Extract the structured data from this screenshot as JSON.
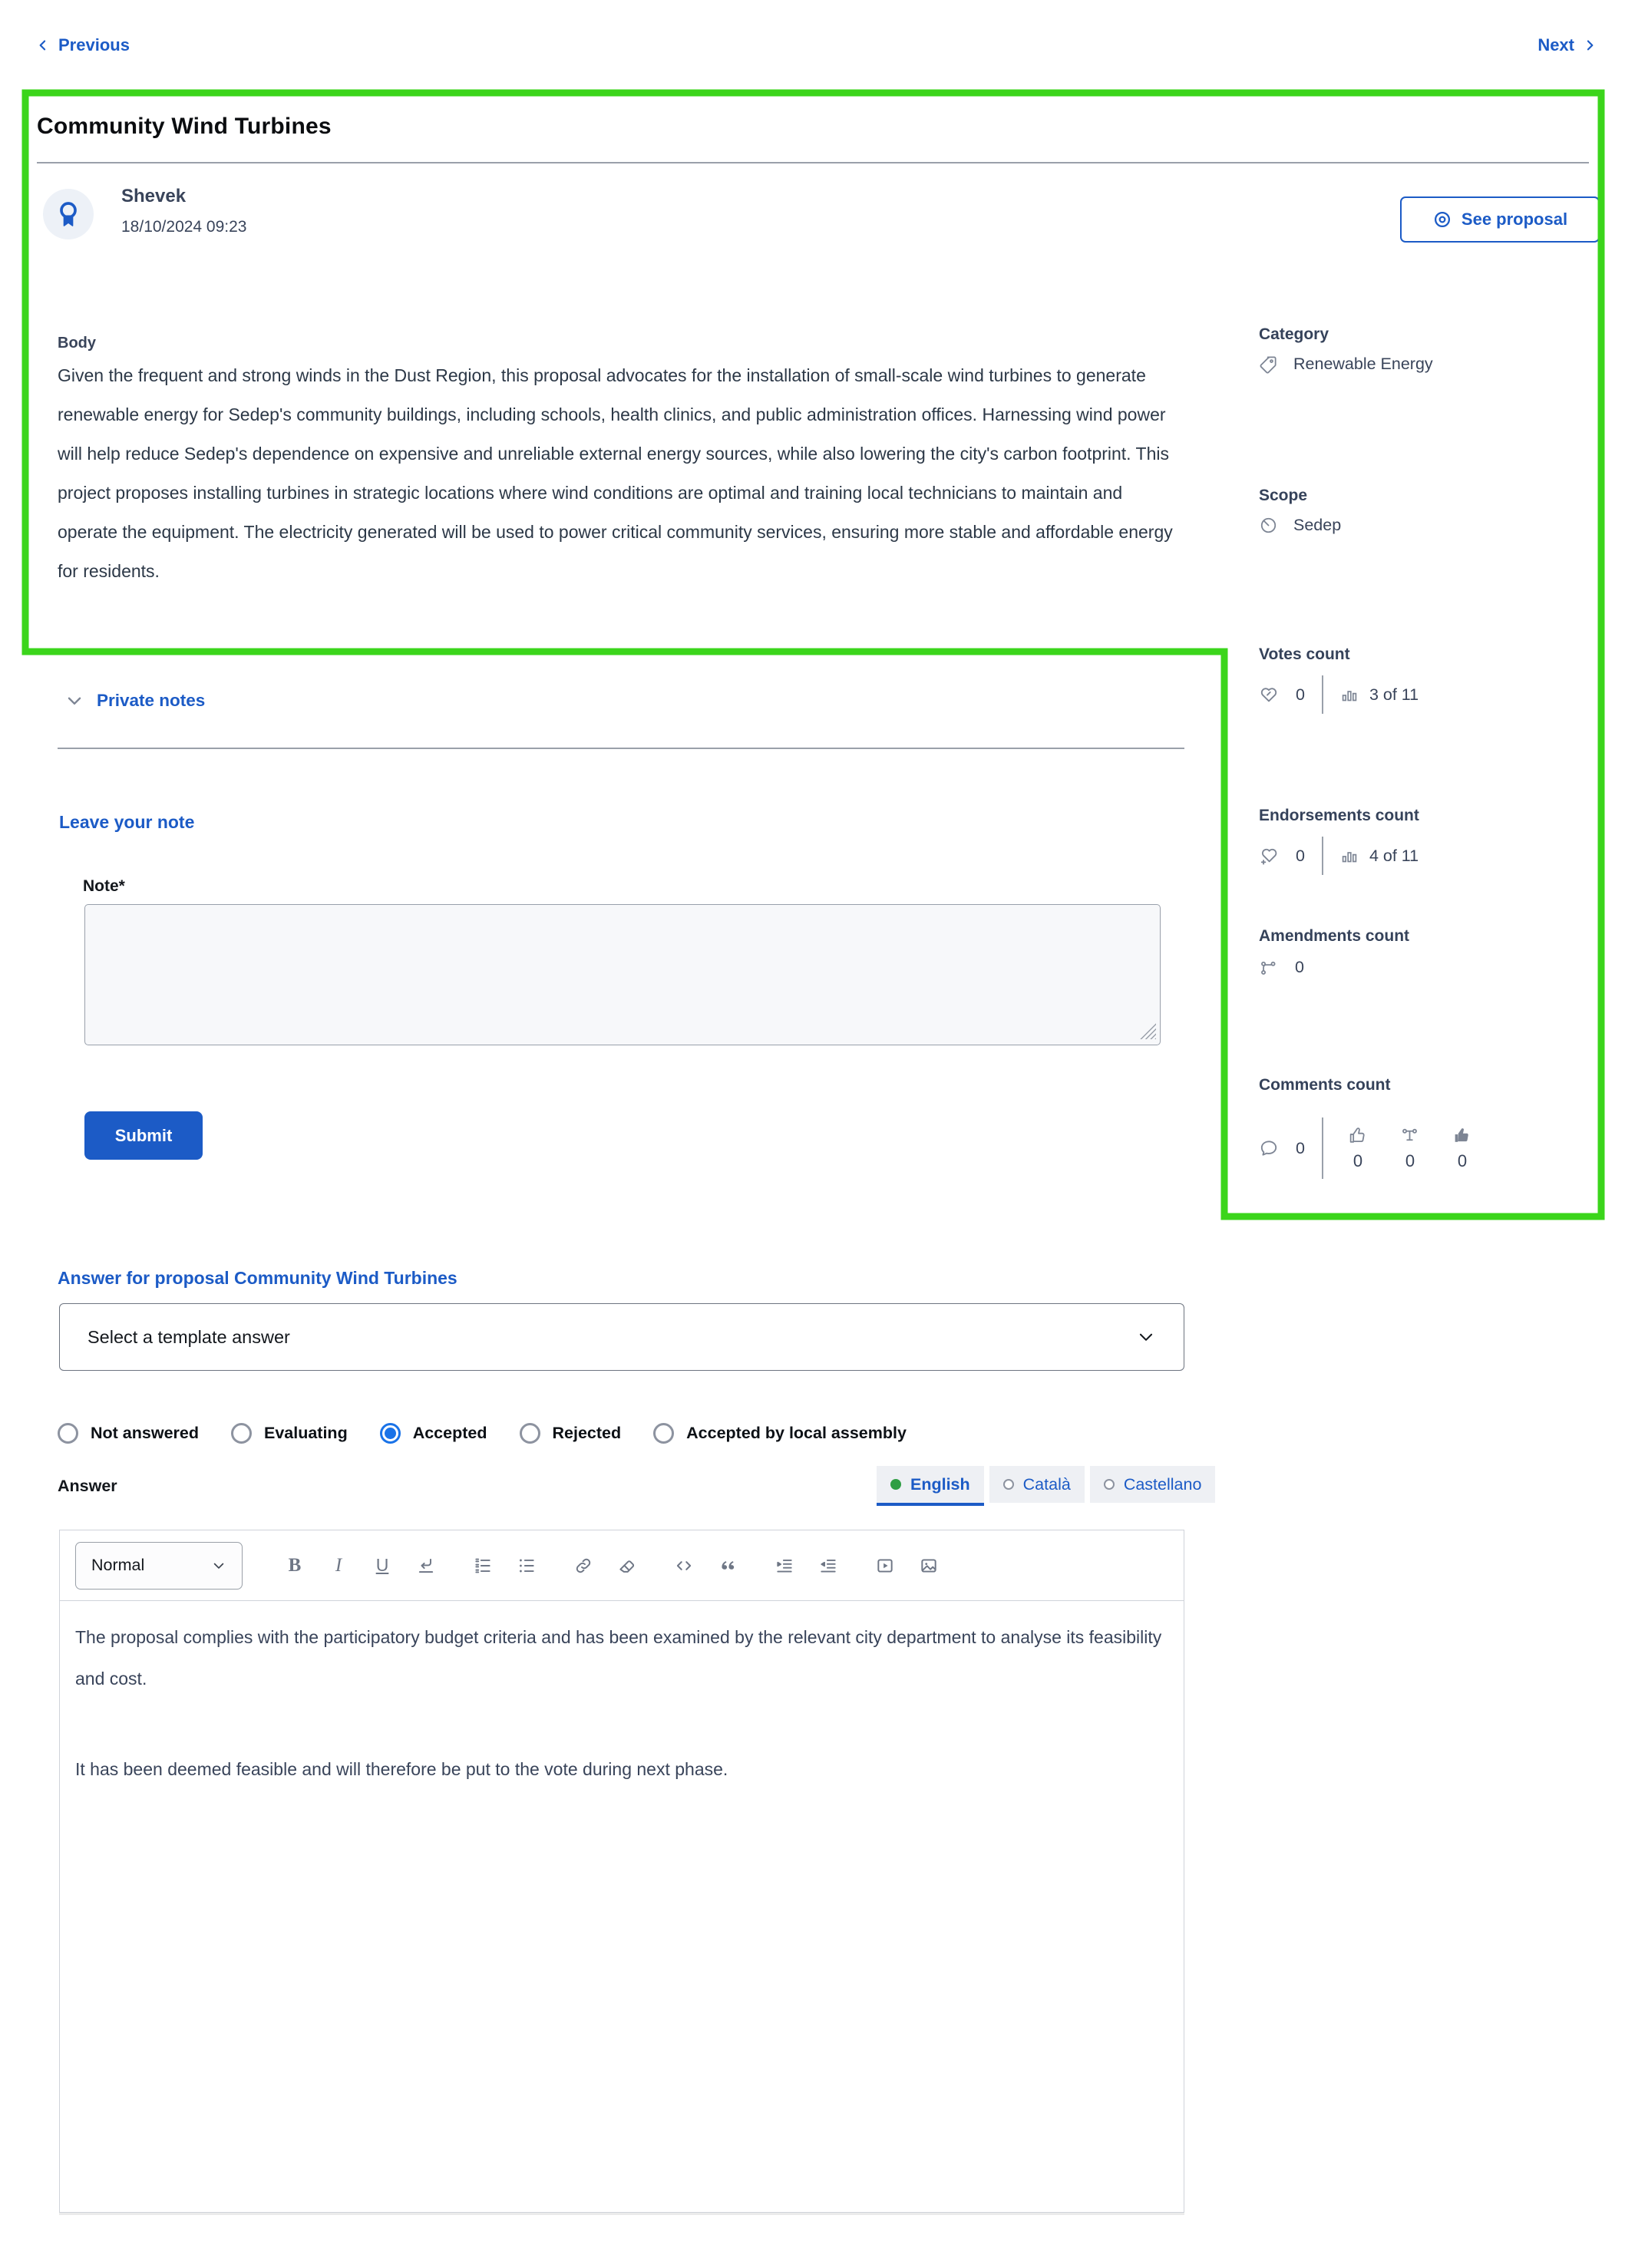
{
  "nav": {
    "previous": "Previous",
    "next": "Next"
  },
  "proposal": {
    "title": "Community Wind Turbines",
    "author": {
      "name": "Shevek",
      "date": "18/10/2024 09:23"
    },
    "see_proposal_label": "See proposal",
    "body_label": "Body",
    "body": "Given the frequent and strong winds in the Dust Region, this proposal advocates for the installation of small-scale wind turbines to generate renewable energy for Sedep's community buildings, including schools, health clinics, and public administration offices. Harnessing wind power will help reduce Sedep's dependence on expensive and unreliable external energy sources, while also lowering the city's carbon footprint. This project proposes installing turbines in strategic locations where wind conditions are optimal and training local technicians to maintain and operate the equipment. The electricity generated will be used to power critical community services, ensuring more stable and affordable energy for residents."
  },
  "details": {
    "category": {
      "label": "Category",
      "value": "Renewable Energy"
    },
    "scope": {
      "label": "Scope",
      "value": "Sedep"
    },
    "votes": {
      "label": "Votes count",
      "count": "0",
      "ranking": "3 of 11"
    },
    "endorsements": {
      "label": "Endorsements count",
      "count": "0",
      "ranking": "4 of 11"
    },
    "amendments": {
      "label": "Amendments count",
      "count": "0"
    },
    "comments": {
      "label": "Comments count",
      "count": "0",
      "positive": "0",
      "neutral": "0",
      "negative": "0"
    }
  },
  "notes": {
    "section_title": "Private notes",
    "heading": "Leave your note",
    "note_label": "Note*",
    "note_value": "",
    "submit_label": "Submit"
  },
  "answer": {
    "heading": "Answer for proposal Community Wind Turbines",
    "template_placeholder": "Select a template answer",
    "statuses": [
      "Not answered",
      "Evaluating",
      "Accepted",
      "Rejected",
      "Accepted by local assembly"
    ],
    "selected_status": "Accepted",
    "answer_label": "Answer",
    "languages": [
      "English",
      "Català",
      "Castellano"
    ],
    "selected_language": "English",
    "editor": {
      "format": "Normal",
      "toolbar": {
        "bold": "B",
        "italic": "I",
        "underline": "U"
      },
      "paragraphs": [
        "The proposal complies with the participatory budget criteria and has been examined by the relevant city department to analyse its feasibility and cost.",
        "It has been deemed feasible and will therefore be put to the vote during next phase."
      ]
    }
  },
  "colors": {
    "accent_blue": "#1c5bc6",
    "annotation_green": "#3bd51b",
    "status_selected_blue": "#1a73e8",
    "language_active_dot_green": "#2f9e44"
  }
}
